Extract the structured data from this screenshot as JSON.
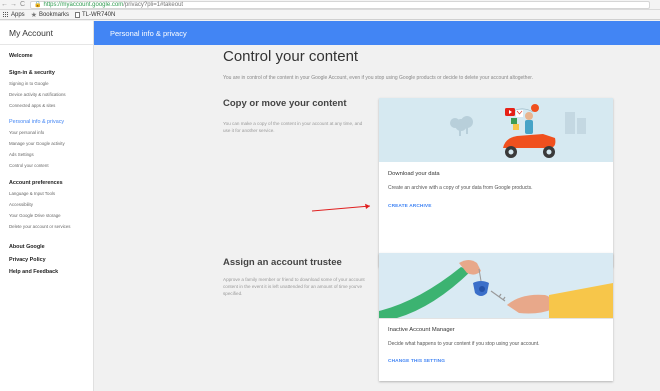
{
  "browser": {
    "back": "←",
    "forward": "→",
    "reload": "C",
    "url_host": "https://myaccount.google.com",
    "url_path": "/privacy?pli=1#takeout"
  },
  "bookmarks": {
    "apps": "Apps",
    "bookmarks": "Bookmarks",
    "tplink": "TL-WR740N"
  },
  "sidebar": {
    "title": "My Account",
    "welcome": "Welcome",
    "signin_security": "Sign-in & security",
    "signin_items": [
      "Signing in to Google",
      "Device activity & notifications",
      "Connected apps & sites"
    ],
    "personal_info_privacy": "Personal info & privacy",
    "privacy_items": [
      "Your personal info",
      "Manage your Google activity",
      "Ads Settings",
      "Control your content"
    ],
    "account_preferences": "Account preferences",
    "preference_items": [
      "Language & Input Tools",
      "Accessibility",
      "Your Google Drive storage",
      "Delete your account or services"
    ],
    "about_google": "About Google",
    "privacy_policy": "Privacy Policy",
    "help_feedback": "Help and Feedback"
  },
  "header": {
    "title": "Personal info & privacy"
  },
  "main": {
    "title": "Control your content",
    "intro": "You are in control of the content in your Google Account, even if you stop using Google products or decide to delete your account altogether.",
    "copy_section": {
      "title": "Copy or move your content",
      "desc": "You can make a copy of the content in your account at any time, and use it for another service."
    },
    "download_card": {
      "title": "Download your data",
      "desc": "Create an archive with a copy of your data from Google products.",
      "link": "CREATE ARCHIVE"
    },
    "trustee_section": {
      "title": "Assign an account trustee",
      "desc": "Approve a family member or friend to download some of your account content in the event it is left unattended for an amount of time you've specified."
    },
    "inactive_card": {
      "title": "Inactive Account Manager",
      "desc": "Decide what happens to your content if you stop using your account.",
      "link": "CHANGE THIS SETTING"
    }
  },
  "colors": {
    "accent": "#4285f4",
    "annotation_arrow": "#e02020",
    "scooter": "#f0501e"
  }
}
